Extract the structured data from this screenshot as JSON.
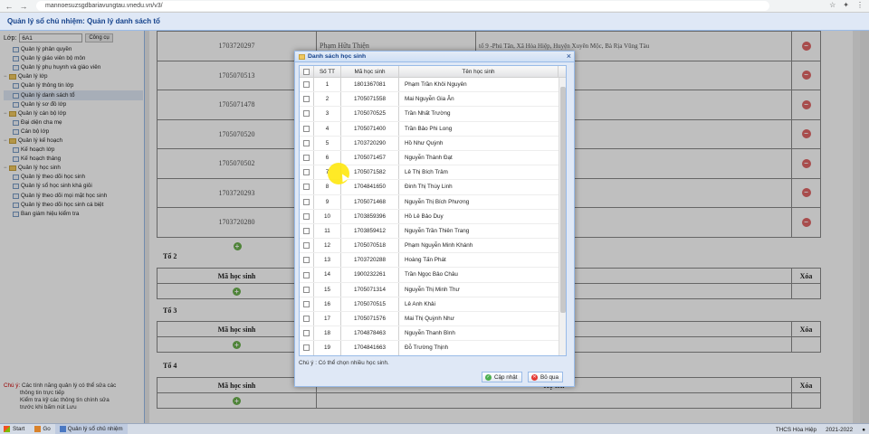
{
  "browser": {
    "url": "mannoesuzsgdbariavungtau.vnedu.vn/v3/",
    "back": "←",
    "forward": "→",
    "reload": "↻",
    "star": "☆"
  },
  "app": {
    "title": "Quản lý sổ chủ nhiệm: Quản lý danh sách tổ"
  },
  "sidebar": {
    "class_label": "Lớp:",
    "class_value": "6A1",
    "tool_label": "Công cụ",
    "items": [
      {
        "label": "Quản lý phân quyền",
        "level": 1
      },
      {
        "label": "Quản lý giáo viên bộ môn",
        "level": 1
      },
      {
        "label": "Quản lý phụ huynh và giáo viên",
        "level": 1
      },
      {
        "label": "Quản lý lớp",
        "level": 0
      },
      {
        "label": "Quản lý thông tin lớp",
        "level": 1
      },
      {
        "label": "Quản lý danh sách tổ",
        "level": 1,
        "selected": true
      },
      {
        "label": "Quản lý sơ đồ lớp",
        "level": 1
      },
      {
        "label": "Quản lý cán bộ lớp",
        "level": 0
      },
      {
        "label": "Đại diện cha mẹ",
        "level": 1
      },
      {
        "label": "Cán bộ lớp",
        "level": 1
      },
      {
        "label": "Quản lý kế hoạch",
        "level": 0
      },
      {
        "label": "Kế hoạch lớp",
        "level": 1
      },
      {
        "label": "Kế hoạch tháng",
        "level": 1
      },
      {
        "label": "Quản lý học sinh",
        "level": 0
      },
      {
        "label": "Quản lý theo dõi học sinh",
        "level": 1
      },
      {
        "label": "Quản lý sổ học sinh khá giỏi",
        "level": 1
      },
      {
        "label": "Quản lý theo dõi mọi mặt học sinh",
        "level": 1
      },
      {
        "label": "Quản lý theo dõi học sinh cá biệt",
        "level": 1
      },
      {
        "label": "Ban giám hiệu kiểm tra",
        "level": 1
      }
    ],
    "note_label": "Chú ý:",
    "note_lines": [
      "Các tính năng quản lý có thể sửa các",
      "thông tin trực tiếp",
      "Kiểm tra kỹ các thông tin chính sửa",
      "trước khi bấm nút Lưu"
    ]
  },
  "main": {
    "rows": [
      {
        "ma": "1703720297",
        "ten": "Phạm Hữu Thiện",
        "dia_chi": "tổ 9 -Phú Tân, Xã Hòa Hiệp, Huyện Xuyên Mộc, Bà Rịa Vũng Tàu"
      },
      {
        "ma": "1705070513",
        "ten": "",
        "dia_chi": "Huyện Xuyên"
      },
      {
        "ma": "1705071478",
        "ten": "",
        "dia_chi": ""
      },
      {
        "ma": "1705070520",
        "ten": "",
        "dia_chi": "Huyện Xuyên Mộc,"
      },
      {
        "ma": "1705070502",
        "ten": "",
        "dia_chi": "Huyện Xuyên"
      },
      {
        "ma": "1703720293",
        "ten": "",
        "dia_chi": "Huyện Xuyên"
      },
      {
        "ma": "1703720280",
        "ten": "",
        "dia_chi": "Huyện Xuyên"
      }
    ],
    "groups": [
      {
        "label": "Tổ 2",
        "col_ma": "Mã học sinh",
        "col_ten": "",
        "col_xoa": "Xóa"
      },
      {
        "label": "Tổ 3",
        "col_ma": "Mã học sinh",
        "col_ten": "",
        "col_xoa": "Xóa"
      },
      {
        "label": "Tổ 4",
        "col_ma": "Mã học sinh",
        "col_ten": "Họ tên",
        "col_xoa": "Xóa"
      }
    ],
    "delete_symbol": "−",
    "add_symbol": "+"
  },
  "modal": {
    "title": "Danh sách học sinh",
    "close": "×",
    "col_stt": "Số TT",
    "col_ma": "Mã học sinh",
    "col_ten": "Tên học sinh",
    "rows": [
      {
        "stt": "1",
        "ma": "1801367081",
        "ten": "Phạm Trần Khôi Nguyên"
      },
      {
        "stt": "2",
        "ma": "1705071558",
        "ten": "Mai Nguyễn Gia Ân"
      },
      {
        "stt": "3",
        "ma": "1705070525",
        "ten": "Trần Nhất Trường"
      },
      {
        "stt": "4",
        "ma": "1705071400",
        "ten": "Trần Bảo Phi Long"
      },
      {
        "stt": "5",
        "ma": "1703720290",
        "ten": "Hồ Như Quỳnh"
      },
      {
        "stt": "6",
        "ma": "1705071457",
        "ten": "Nguyễn Thành Đạt"
      },
      {
        "stt": "7",
        "ma": "1705071582",
        "ten": "Lê Thị Bích Trâm"
      },
      {
        "stt": "8",
        "ma": "1704841650",
        "ten": "Đinh Thị Thùy Linh"
      },
      {
        "stt": "9",
        "ma": "1705071468",
        "ten": "Nguyễn Thị Bích Phương"
      },
      {
        "stt": "10",
        "ma": "1703859396",
        "ten": "Hồ Lê Bảo Duy"
      },
      {
        "stt": "11",
        "ma": "1703859412",
        "ten": "Nguyễn Trần Thiên Trang"
      },
      {
        "stt": "12",
        "ma": "1705070518",
        "ten": "Phạm Nguyễn Minh Khánh"
      },
      {
        "stt": "13",
        "ma": "1703720288",
        "ten": "Hoàng Tấn Phát"
      },
      {
        "stt": "14",
        "ma": "1900232261",
        "ten": "Trần Ngọc Bảo Châu"
      },
      {
        "stt": "15",
        "ma": "1705071314",
        "ten": "Nguyễn Thị Minh Thư"
      },
      {
        "stt": "16",
        "ma": "1705070515",
        "ten": "Lê Anh Khải"
      },
      {
        "stt": "17",
        "ma": "1705071576",
        "ten": "Mai Thị Quỳnh Như"
      },
      {
        "stt": "18",
        "ma": "1704878463",
        "ten": "Nguyễn Thanh Bình"
      },
      {
        "stt": "19",
        "ma": "1704841663",
        "ten": "Đỗ Trường Thịnh"
      }
    ],
    "note": "Chú ý : Có thể chọn nhiều học sinh.",
    "ok_label": "Cập nhật",
    "skip_label": "Bỏ qua"
  },
  "taskbar": {
    "start": "Start",
    "go": "Go",
    "app": "Quản lý sổ chủ nhiệm",
    "school": "THCS Hòa Hiệp",
    "year": "2021-2022"
  }
}
